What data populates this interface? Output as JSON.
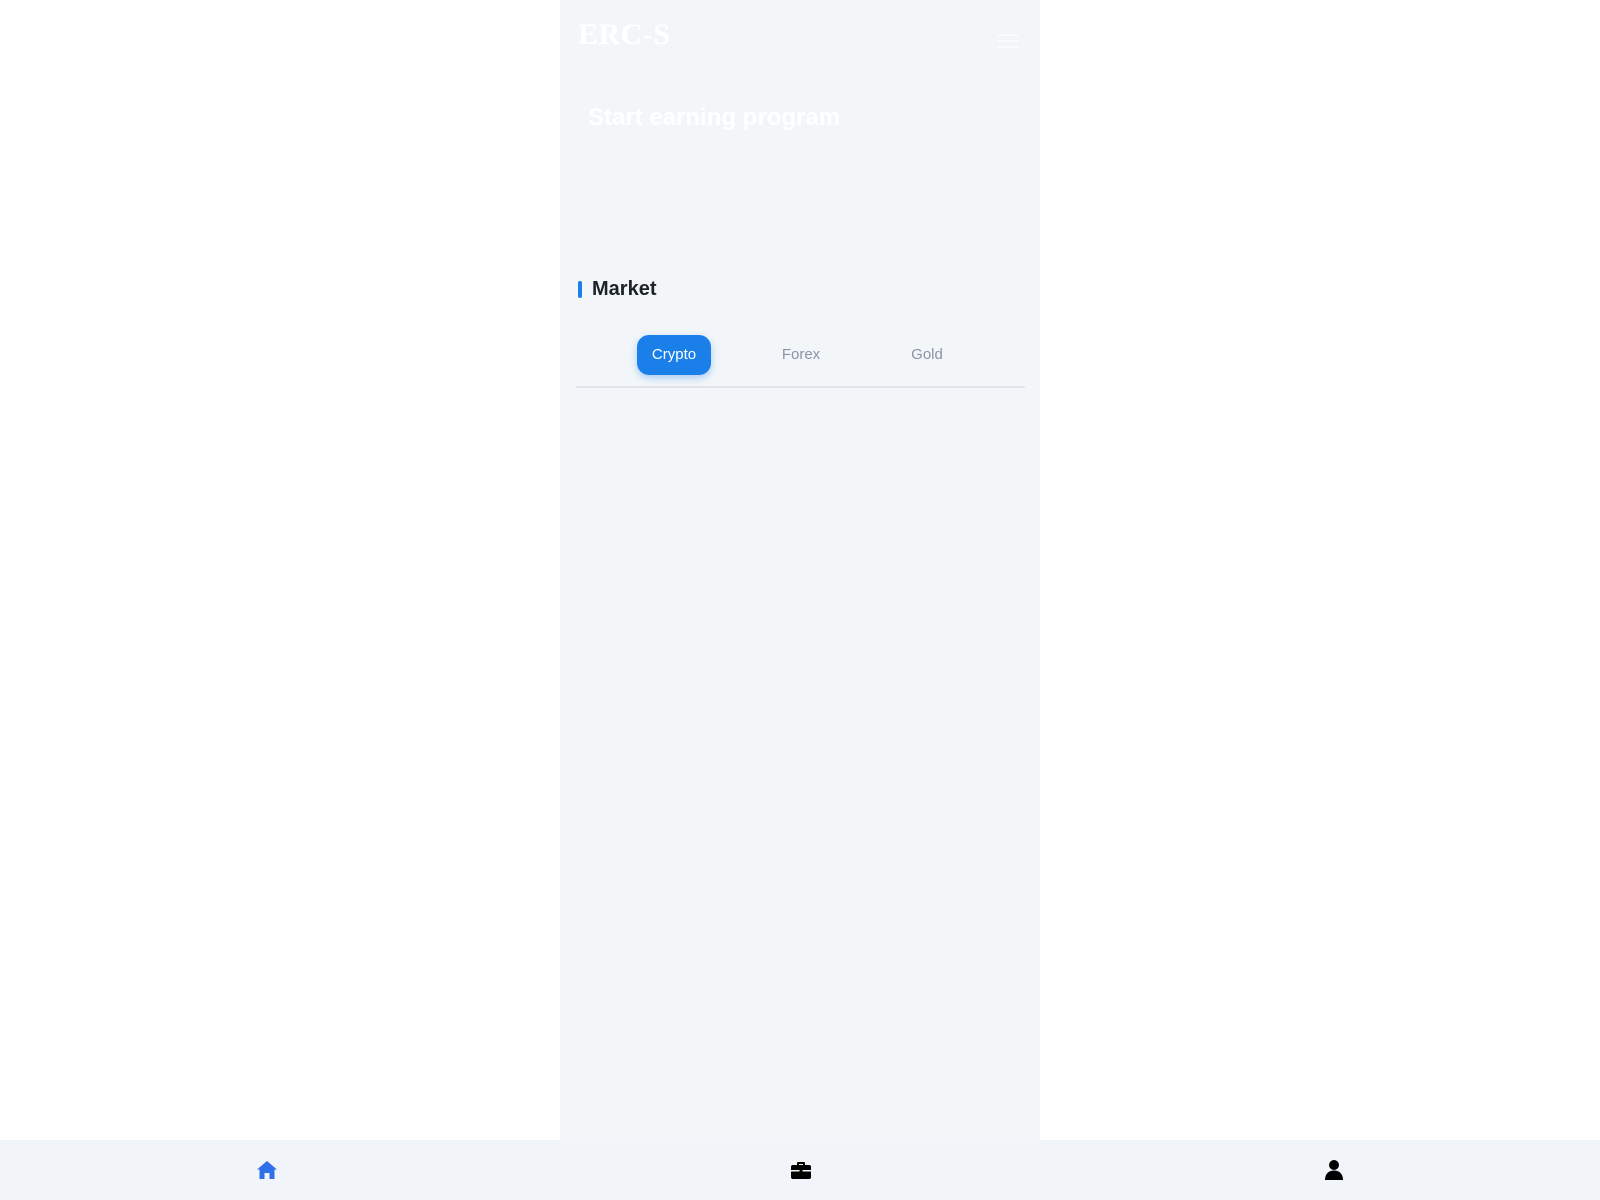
{
  "header": {
    "logo_text": "ERC-S",
    "menu_icon": "menu-icon"
  },
  "banner": {
    "title": "Start earning program"
  },
  "market": {
    "title": "Market",
    "tabs": [
      {
        "label": "Crypto",
        "active": true
      },
      {
        "label": "Forex",
        "active": false
      },
      {
        "label": "Gold",
        "active": false
      }
    ]
  },
  "bottom_nav": {
    "items": [
      {
        "icon": "home-icon",
        "active": true
      },
      {
        "icon": "briefcase-icon",
        "active": false
      },
      {
        "icon": "user-icon",
        "active": false
      }
    ]
  },
  "colors": {
    "accent": "#1a7fe8",
    "nav_active": "#2f6fe8",
    "nav_inactive": "#000000",
    "app_background": "#f3f6f9",
    "page_background": "#fefefe"
  }
}
